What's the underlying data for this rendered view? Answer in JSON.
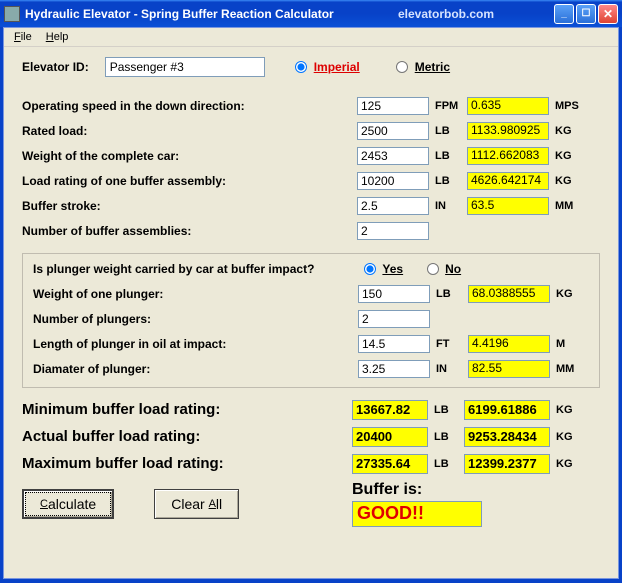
{
  "window": {
    "title": "Hydraulic Elevator - Spring Buffer Reaction Calculator",
    "url": "elevatorbob.com"
  },
  "menu": {
    "file": "File",
    "help": "Help"
  },
  "labels": {
    "elevator_id": "Elevator ID:",
    "imperial": "Imperial",
    "metric": "Metric",
    "speed": "Operating speed in the down direction:",
    "rated": "Rated load:",
    "car_wt": "Weight of the complete car:",
    "buf_load": "Load rating of one buffer assembly:",
    "stroke": "Buffer stroke:",
    "n_buf": "Number of buffer assemblies:",
    "plunger_q": "Is plunger weight carried by car at buffer impact?",
    "yes": "Yes",
    "no": "No",
    "plunger_wt": "Weight of one plunger:",
    "n_plunger": "Number of plungers:",
    "plunger_len": "Length of plunger in oil at impact:",
    "plunger_dia": "Diamater of plunger:",
    "min": "Minimum buffer load rating:",
    "act": "Actual buffer load rating:",
    "max": "Maximum buffer load rating:",
    "buffer_is": "Buffer is:",
    "calc": "Calculate",
    "clear": "Clear All"
  },
  "units": {
    "fpm": "FPM",
    "mps": "MPS",
    "lb": "LB",
    "kg": "KG",
    "in": "IN",
    "mm": "MM",
    "ft": "FT",
    "m": "M"
  },
  "values": {
    "elevator_id": "Passenger #3",
    "speed": "125",
    "speed_m": "0.635",
    "rated": "2500",
    "rated_m": "1133.980925",
    "car_wt": "2453",
    "car_wt_m": "1112.662083",
    "buf_load": "10200",
    "buf_load_m": "4626.642174",
    "stroke": "2.5",
    "stroke_m": "63.5",
    "n_buf": "2",
    "plunger_wt": "150",
    "plunger_wt_m": "68.0388555",
    "n_plunger": "2",
    "plunger_len": "14.5",
    "plunger_len_m": "4.4196",
    "plunger_dia": "3.25",
    "plunger_dia_m": "82.55",
    "min": "13667.82",
    "min_m": "6199.61886",
    "act": "20400",
    "act_m": "9253.28434",
    "max": "27335.64",
    "max_m": "12399.2377",
    "status": "GOOD!!"
  }
}
